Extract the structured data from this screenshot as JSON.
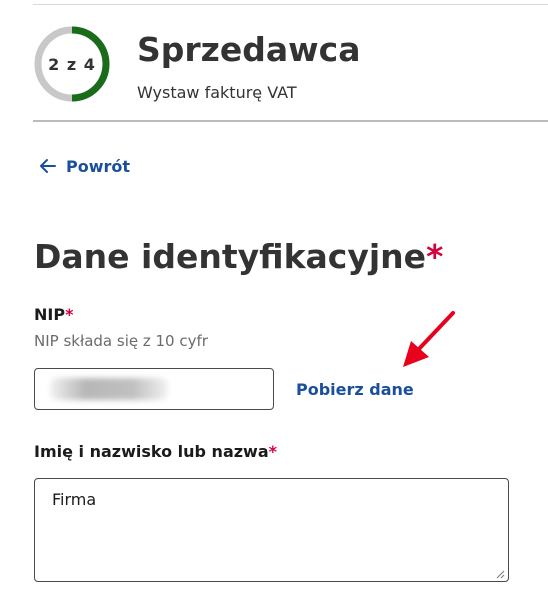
{
  "header": {
    "progress_text": "2 z 4",
    "progress_fraction": 0.5,
    "title": "Sprzedawca",
    "subtitle": "Wystaw fakturę VAT"
  },
  "nav": {
    "back_label": "Powrót"
  },
  "section": {
    "title": "Dane identyfikacyjne",
    "required_mark": "*"
  },
  "nip": {
    "label": "NIP",
    "required_mark": "*",
    "hint": "NIP składa się z 10 cyfr",
    "value": "",
    "fetch_label": "Pobierz dane"
  },
  "name_field": {
    "label": "Imię i nazwisko lub nazwa",
    "required_mark": "*",
    "value": "Firma"
  },
  "colors": {
    "accent_link": "#1a4f9b",
    "progress_done": "#1a6b1a",
    "progress_todo": "#c8c8c8",
    "required": "#d4003d",
    "annotation_arrow": "#e8001c"
  }
}
